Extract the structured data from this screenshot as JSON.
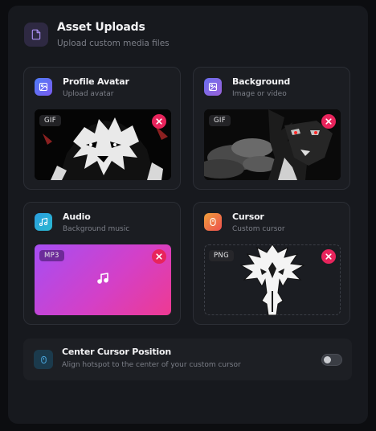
{
  "header": {
    "title": "Asset Uploads",
    "subtitle": "Upload custom media files",
    "icon": "file-icon"
  },
  "cards": [
    {
      "title": "Profile Avatar",
      "subtitle": "Upload avatar",
      "badge": "GIF",
      "icon": "image-icon",
      "icon_color": "#5b6cf5"
    },
    {
      "title": "Background",
      "subtitle": "Image or video",
      "badge": "GIF",
      "icon": "image-icon",
      "icon_color": "#7b66e0"
    },
    {
      "title": "Audio",
      "subtitle": "Background music",
      "badge": "MP3",
      "icon": "music-icon",
      "icon_color": "#2a9ee0"
    },
    {
      "title": "Cursor",
      "subtitle": "Custom cursor",
      "badge": "PNG",
      "icon": "mouse-icon",
      "icon_color": "#f07a3a"
    }
  ],
  "center_cursor": {
    "title": "Center Cursor Position",
    "subtitle": "Align hotspot to the center of your custom cursor",
    "enabled": false
  },
  "colors": {
    "remove_button": "#e8245c",
    "audio_gradient_start": "#a64ef3",
    "audio_gradient_end": "#ee3a92"
  }
}
